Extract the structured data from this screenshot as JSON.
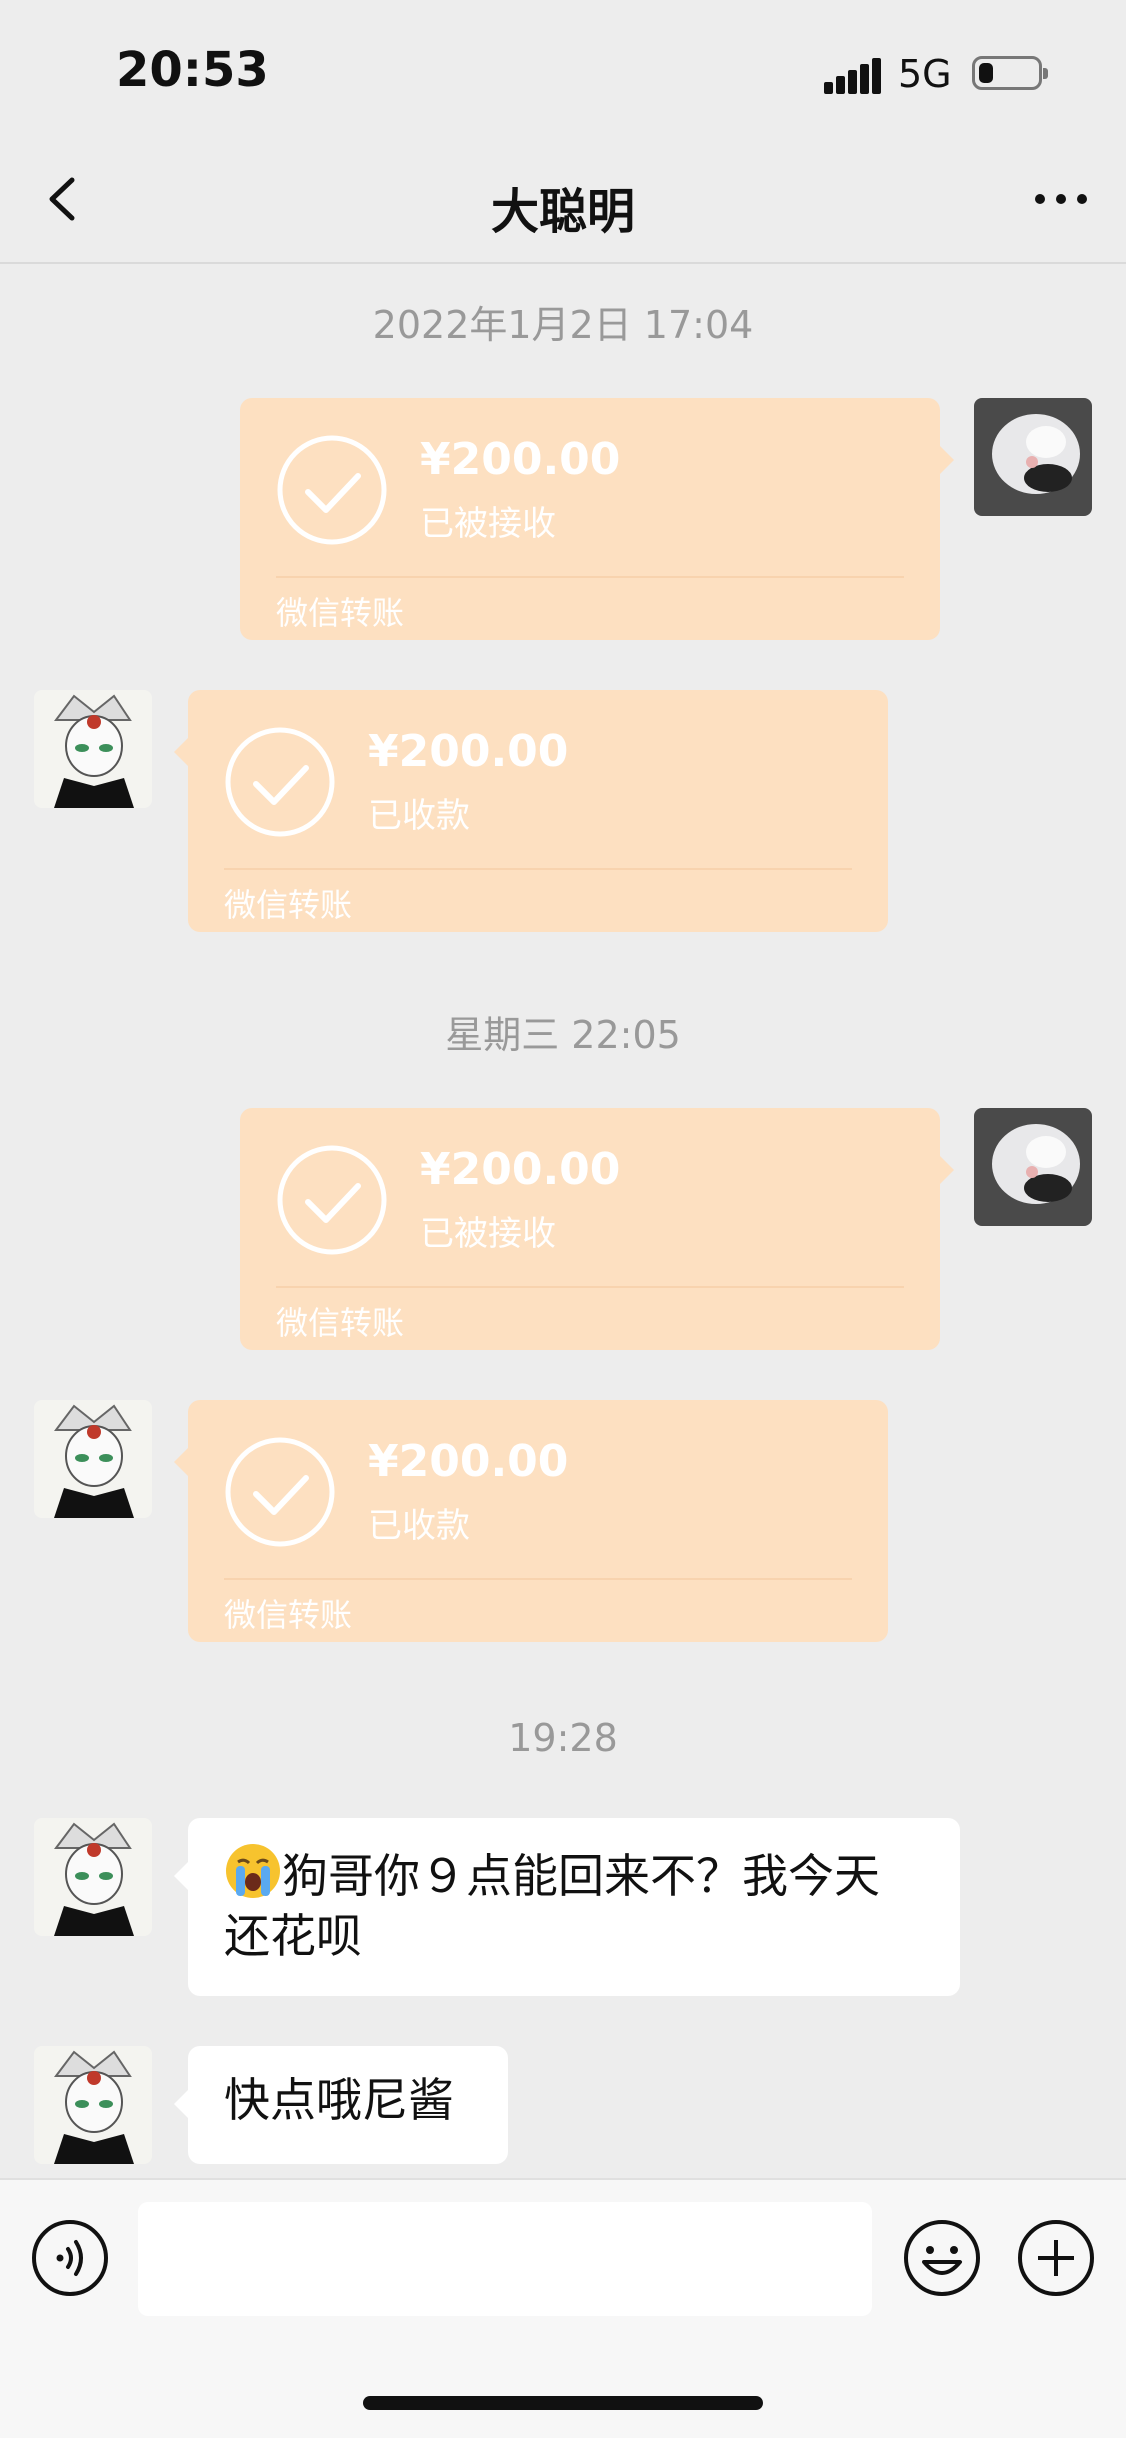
{
  "status_bar": {
    "time": "20:53",
    "network": "5G",
    "battery_percent": 20
  },
  "header": {
    "title": "大聪明"
  },
  "timestamps": [
    "2022年1月2日 17:04",
    "星期三 22:05",
    "19:28"
  ],
  "transfers": [
    {
      "side": "right",
      "amount": "¥200.00",
      "status": "已被接收",
      "label": "微信转账"
    },
    {
      "side": "left",
      "amount": "¥200.00",
      "status": "已收款",
      "label": "微信转账"
    },
    {
      "side": "right",
      "amount": "¥200.00",
      "status": "已被接收",
      "label": "微信转账"
    },
    {
      "side": "left",
      "amount": "¥200.00",
      "status": "已收款",
      "label": "微信转账"
    }
  ],
  "messages": [
    {
      "emoji": "crying-face-icon",
      "text": "狗哥你９点能回来不？我今天还花呗"
    },
    {
      "text": "快点哦尼酱"
    }
  ],
  "input": {
    "placeholder": ""
  },
  "colors": {
    "background": "#ededed",
    "transfer_bubble": "#fde0c1",
    "text_bubble": "#ffffff"
  }
}
